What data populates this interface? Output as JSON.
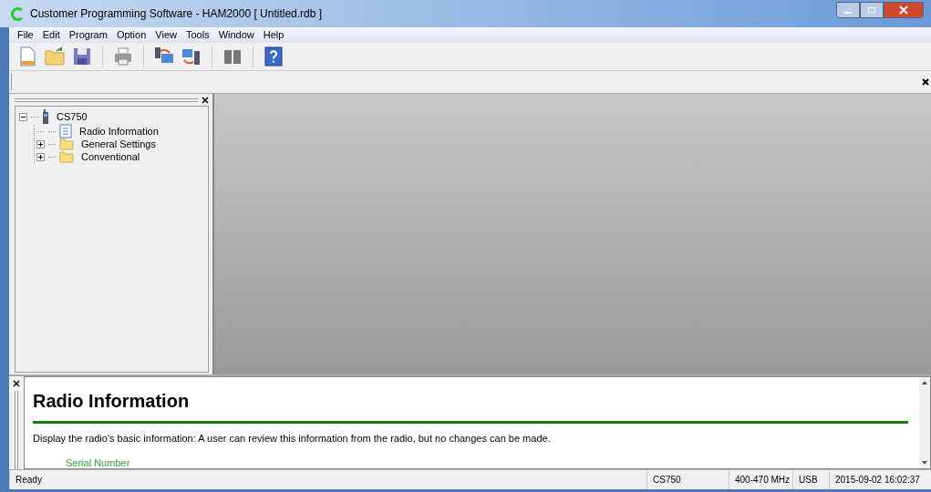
{
  "window": {
    "title": "Customer Programming Software - HAM2000 [ Untitled.rdb ]"
  },
  "menu": [
    "File",
    "Edit",
    "Program",
    "Option",
    "View",
    "Tools",
    "Window",
    "Help"
  ],
  "toolbar": [
    {
      "kind": "new"
    },
    {
      "kind": "open"
    },
    {
      "kind": "save"
    },
    {
      "kind": "sep"
    },
    {
      "kind": "print"
    },
    {
      "kind": "sep"
    },
    {
      "kind": "read"
    },
    {
      "kind": "write"
    },
    {
      "kind": "sep"
    },
    {
      "kind": "clone"
    },
    {
      "kind": "sep"
    },
    {
      "kind": "help"
    }
  ],
  "tree": [
    {
      "label": "CS750",
      "kind": "radio",
      "expanded": true,
      "children": [
        {
          "label": "Radio Information",
          "kind": "page"
        },
        {
          "label": "General Settings",
          "kind": "folder",
          "expanded": false
        },
        {
          "label": "Conventional",
          "kind": "folder",
          "expanded": false
        }
      ]
    }
  ],
  "help": {
    "heading": "Radio Information",
    "text": "Display the radio's basic information: A user can review this information from the radio, but no changes can be made.",
    "items": [
      "Serial Number"
    ]
  },
  "status_bar": [
    "Ready",
    "CS750",
    "400-470 MHz",
    "USB",
    "2015-09-02 16:02:37"
  ]
}
